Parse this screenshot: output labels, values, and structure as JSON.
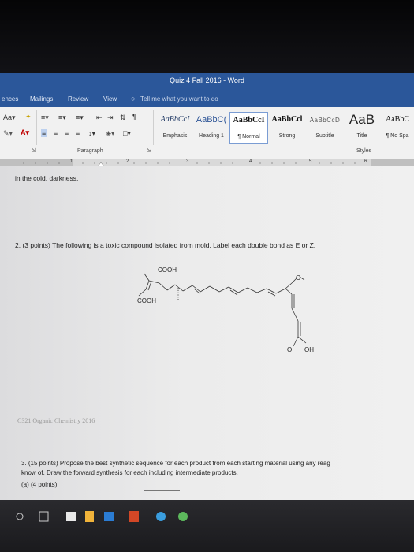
{
  "window": {
    "title": "Quiz 4 Fall 2016 - Word"
  },
  "tabs": [
    "ences",
    "Mailings",
    "Review",
    "View"
  ],
  "tell_me": "Tell me what you want to do",
  "ribbon": {
    "font_size_label": "Aa",
    "paragraph_label": "Paragraph",
    "styles_label": "Styles",
    "styles": [
      {
        "sample": "AaBbCcI",
        "name": "Emphasis"
      },
      {
        "sample": "AaBbC(",
        "name": "Heading 1"
      },
      {
        "sample": "AaBbCcI",
        "name": "¶ Normal",
        "selected": true
      },
      {
        "sample": "AaBbCcl",
        "name": "Strong"
      },
      {
        "sample": "AaBbCcD",
        "name": "Subtitle"
      },
      {
        "sample": "AaB",
        "name": "Title"
      },
      {
        "sample": "AaBbC",
        "name": "¶ No Spa"
      }
    ]
  },
  "ruler": {
    "numbers": [
      "1",
      "2",
      "3",
      "4",
      "5",
      "6"
    ]
  },
  "document": {
    "line1": "in the cold, darkness.",
    "q2": "2. (3 points) The following is a toxic compound isolated from mold. Label each double bond as E or Z.",
    "molecule": {
      "cooh_top": "COOH",
      "cooh_left": "COOH",
      "o_right": "O",
      "o_bottom": "O",
      "oh": "OH"
    },
    "footer": "C321 Organic Chemistry 2016",
    "q3_line1": "3. (15 points) Propose the best synthetic sequence for each product from each starting material using any reag",
    "q3_line2": "know of. Draw the forward synthesis for each including intermediate products.",
    "q3a": "(a) (4 points)"
  },
  "colors": {
    "word_blue": "#2b579a",
    "ribbon_bg": "#f1f1f1"
  }
}
